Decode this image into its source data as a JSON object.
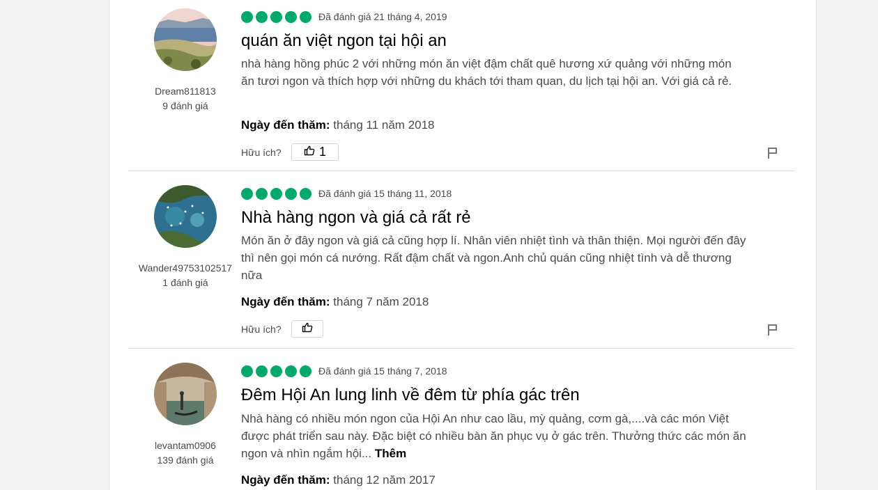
{
  "colors": {
    "bubble": "#00aa6c",
    "text": "#4a4a4a",
    "title": "#000000"
  },
  "labels": {
    "helpful": "Hữu ích?",
    "visit_date": "Ngày đến thăm:",
    "more": "Thêm"
  },
  "reviews": [
    {
      "user": "Dream811813",
      "user_reviews": "9 đánh giá",
      "rating": 5,
      "date": "Đã đánh giá 21 tháng 4, 2019",
      "title": "quán ăn việt ngon tại hội an",
      "body": "nhà hàng hồng phúc 2 với những món ăn việt đậm chất quê hương xứ quảng với những món ăn tươi ngon và thích hợp với những du khách tới tham quan, du lịch tại hội an. Với giá cả rẻ.",
      "visit": "tháng 11 năm 2018",
      "helpful_count": "1"
    },
    {
      "user": "Wander49753102517",
      "user_reviews": "1 đánh giá",
      "rating": 5,
      "date": "Đã đánh giá 15 tháng 11, 2018",
      "title": "Nhà hàng ngon và giá cả rất rẻ",
      "body": "Món ăn ở đây ngon và giá cả cũng hợp lí. Nhân viên nhiệt tình và thân thiện. Mọi người đến đây thì nên gọi món cá nướng. Rất đậm chất và ngon.Anh chủ quán cũng nhiệt tình và dễ thương nữa",
      "visit": "tháng 7 năm 2018",
      "helpful_count": ""
    },
    {
      "user": "levantam0906",
      "user_reviews": "139 đánh giá",
      "rating": 5,
      "date": "Đã đánh giá 15 tháng 7, 2018",
      "title": "Đêm Hội An lung linh về đêm từ phía gác trên",
      "body": "Nhà hàng có nhiều món ngon của Hội An như cao lầu, mỳ quảng, cơm gà,....và các món Việt được phát triển sau này. Đặc biệt có nhiều bàn ăn phục vụ ở gác trên. Thưởng thức các món ăn ngon và nhìn ngắm hội...",
      "visit": "tháng 12 năm 2017",
      "helpful_count": ""
    }
  ]
}
